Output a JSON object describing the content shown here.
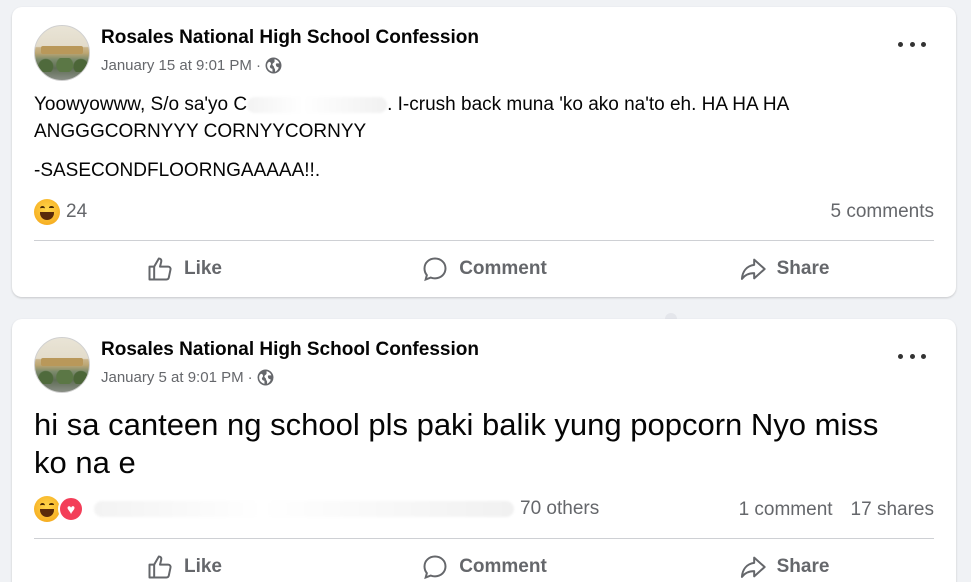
{
  "posts": [
    {
      "page_name": "Rosales National High School Confession",
      "date": "January 15 at 9:01 PM",
      "separator": "·",
      "text_before": "Yoowyowww, S/o sa'yo C",
      "text_after": ". I-crush back muna 'ko ako na'to eh. HA HA HA ANGGGCORNYYY CORNYYCORNYY",
      "text_line2": "-SASECONDFLOORNGAAAAA!!.",
      "reaction_count": "24",
      "comments": "5 comments",
      "shares": "",
      "actions": {
        "like": "Like",
        "comment": "Comment",
        "share": "Share"
      }
    },
    {
      "page_name": "Rosales National High School Confession",
      "date": "January 5 at 9:01 PM",
      "separator": "·",
      "text": "hi sa canteen ng school pls paki balik yung popcorn Nyo miss ko na e",
      "reaction_others": "70 others",
      "comments": "1 comment",
      "shares": "17 shares",
      "actions": {
        "like": "Like",
        "comment": "Comment",
        "share": "Share"
      }
    }
  ],
  "icons": {
    "visibility": "globe-icon",
    "menu": "more-options-icon",
    "like": "thumbs-up-icon",
    "comment": "speech-bubble-icon",
    "share": "share-arrow-icon",
    "reaction1": "haha-emoji-icon",
    "reaction2": "love-heart-icon"
  },
  "colors": {
    "background": "#f0f2f5",
    "card": "#ffffff",
    "secondary_text": "#65676b",
    "love": "#f33e58",
    "haha": "#f7b125"
  }
}
